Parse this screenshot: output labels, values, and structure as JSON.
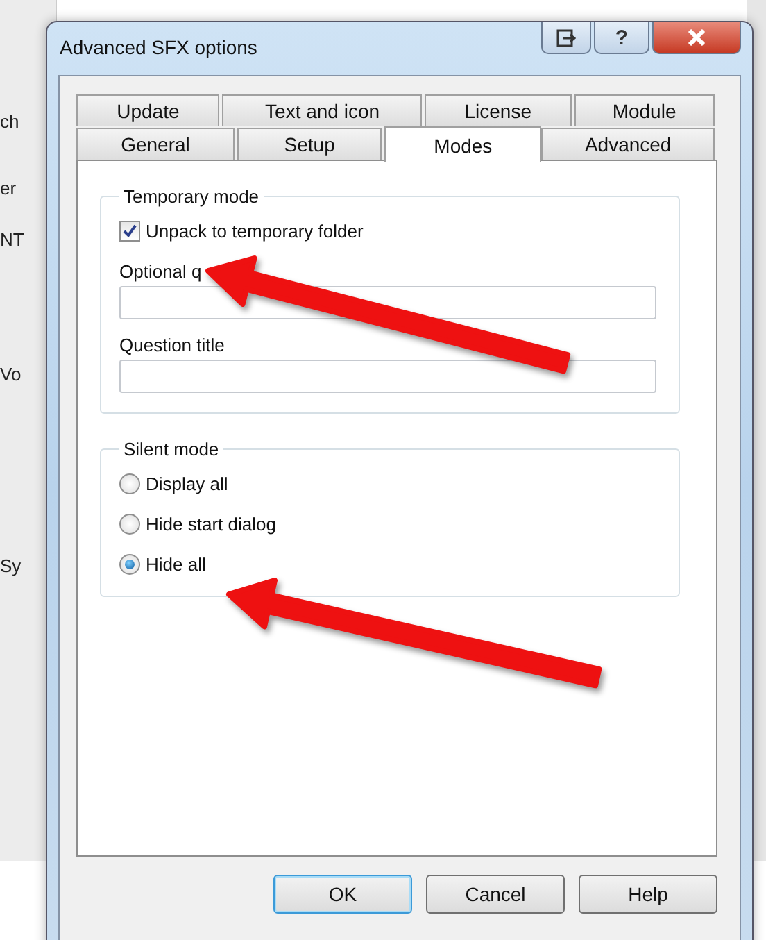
{
  "background_window": {
    "fragments": [
      "ch",
      "er",
      "NT",
      "Vo",
      "Sy"
    ]
  },
  "window": {
    "title": "Advanced SFX options",
    "help_button": "?"
  },
  "tab_rows": [
    {
      "tabs": [
        {
          "label": "Update",
          "selected": false
        },
        {
          "label": "Text and icon",
          "selected": false
        },
        {
          "label": "License",
          "selected": false
        },
        {
          "label": "Module",
          "selected": false
        }
      ]
    },
    {
      "tabs": [
        {
          "label": "General",
          "selected": false
        },
        {
          "label": "Setup",
          "selected": false
        },
        {
          "label": "Modes",
          "selected": true
        },
        {
          "label": "Advanced",
          "selected": false
        }
      ]
    }
  ],
  "temporary_mode": {
    "title": "Temporary mode",
    "checkbox": {
      "label": "Unpack to temporary folder",
      "checked": true
    },
    "fields": [
      {
        "label": "Optional q"
      },
      {
        "label": "Question title"
      }
    ]
  },
  "silent_mode": {
    "title": "Silent mode",
    "options": [
      {
        "label": "Display all",
        "selected": false
      },
      {
        "label": "Hide start dialog",
        "selected": false
      },
      {
        "label": "Hide all",
        "selected": true
      }
    ]
  },
  "buttons": [
    {
      "label": "OK",
      "default": true
    },
    {
      "label": "Cancel",
      "default": false
    },
    {
      "label": "Help",
      "default": false
    }
  ]
}
